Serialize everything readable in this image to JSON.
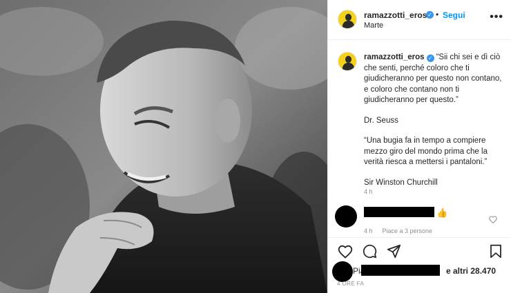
{
  "post": {
    "photo_icon": "portrait-photo"
  },
  "header": {
    "username": "ramazzotti_eros",
    "verified_mark": "✓",
    "separator": "•",
    "follow_label": "Segui",
    "location": "Marte",
    "more_label": "•••"
  },
  "caption": {
    "username": "ramazzotti_eros",
    "paragraphs": [
      "“Sii chi sei e dì ciò che senti, perché coloro che ti giudicheranno per questo non contano, e coloro che contano non ti giudicheranno per questo.”",
      "Dr. Seuss",
      "“Una bugia fa in tempo a compiere mezzo giro del mondo prima che la verità riesca a mettersi i pantaloni.”",
      "Sir Winston Churchill"
    ],
    "time": "4 h"
  },
  "comment": {
    "thumb_emoji": "👍",
    "time": "4 h",
    "likes_text": "Piace a 3 persone"
  },
  "actions": {
    "icons": [
      "heart-icon",
      "comment-icon",
      "share-icon",
      "bookmark-icon"
    ]
  },
  "likes": {
    "prefix": "Pia",
    "rest": "e altri 28.470"
  },
  "posted_time": "4 ORE FA",
  "colors": {
    "accent": "#0095f6",
    "verified": "#3897f0",
    "muted": "#8e8e8e",
    "avatar_bg": "#f4d21b"
  }
}
